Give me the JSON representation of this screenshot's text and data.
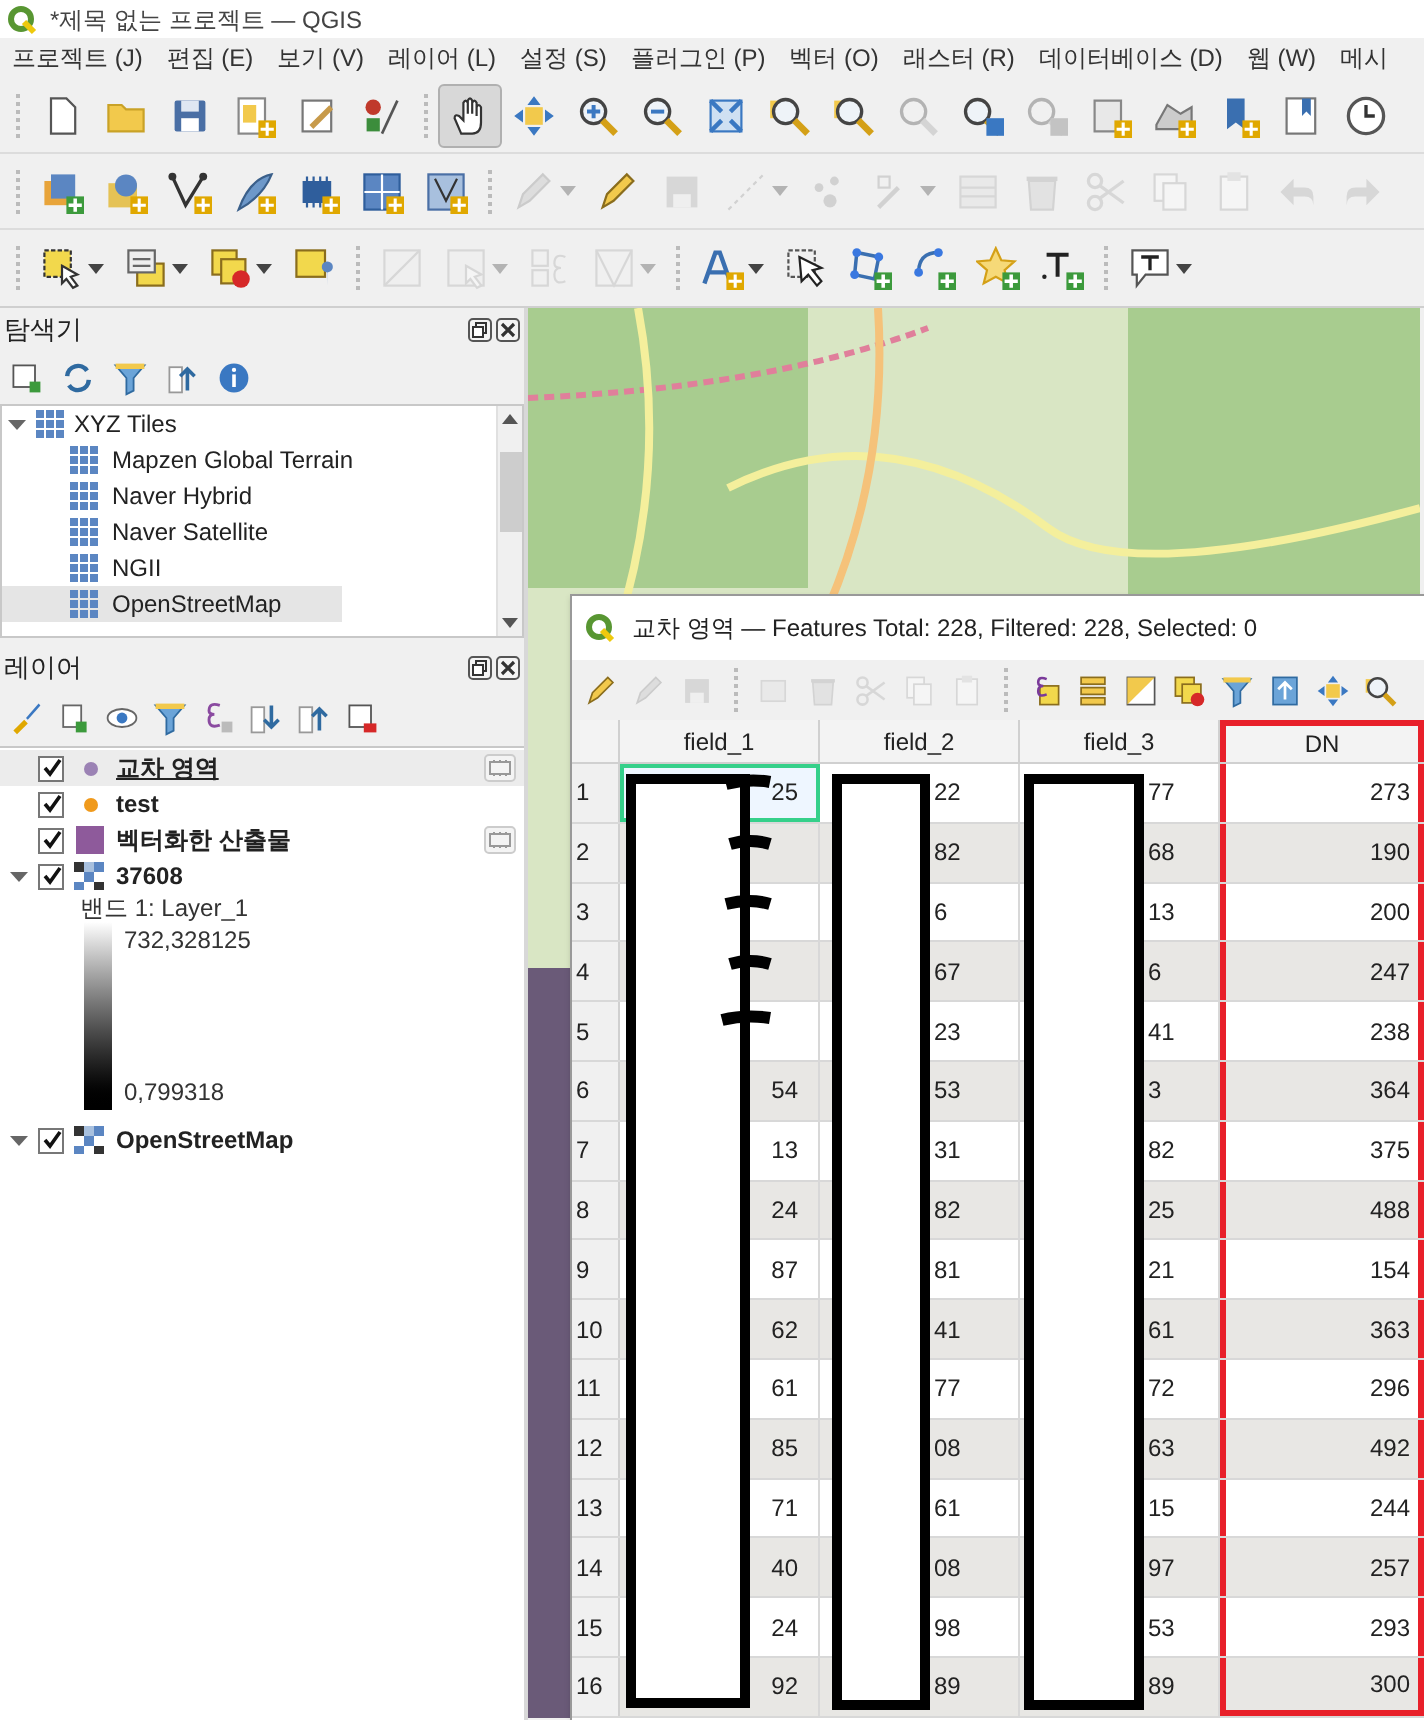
{
  "window": {
    "title": "*제목 없는 프로젝트 — QGIS"
  },
  "menu_bar": [
    "프로젝트 (J)",
    "편집 (E)",
    "보기 (V)",
    "레이어 (L)",
    "설정 (S)",
    "플러그인 (P)",
    "벡터 (O)",
    "래스터 (R)",
    "데이터베이스 (D)",
    "웹 (W)",
    "메시"
  ],
  "toolbars": [
    [
      {
        "kind": "new-file",
        "disabled": false,
        "active": false,
        "dropdown": false
      },
      {
        "kind": "open",
        "disabled": false,
        "active": false,
        "dropdown": false
      },
      {
        "kind": "save",
        "disabled": false,
        "active": false,
        "dropdown": false
      },
      {
        "kind": "new-layout",
        "disabled": false,
        "active": false,
        "dropdown": false
      },
      {
        "kind": "layout-manager",
        "disabled": false,
        "active": false,
        "dropdown": false
      },
      {
        "kind": "style-manager",
        "disabled": false,
        "active": false,
        "dropdown": false
      },
      {
        "kind": "separator",
        "disabled": false,
        "active": false,
        "dropdown": false
      },
      {
        "kind": "pan",
        "disabled": false,
        "active": true,
        "dropdown": false
      },
      {
        "kind": "pan-selection",
        "disabled": false,
        "active": false,
        "dropdown": false
      },
      {
        "kind": "zoom-in",
        "disabled": false,
        "active": false,
        "dropdown": false
      },
      {
        "kind": "zoom-out",
        "disabled": false,
        "active": false,
        "dropdown": false
      },
      {
        "kind": "zoom-full",
        "disabled": false,
        "active": false,
        "dropdown": false
      },
      {
        "kind": "zoom-layer",
        "disabled": false,
        "active": false,
        "dropdown": false
      },
      {
        "kind": "zoom-selection",
        "disabled": false,
        "active": false,
        "dropdown": false
      },
      {
        "kind": "zoom-native",
        "disabled": true,
        "active": false,
        "dropdown": false
      },
      {
        "kind": "zoom-last",
        "disabled": false,
        "active": false,
        "dropdown": false
      },
      {
        "kind": "zoom-next",
        "disabled": true,
        "active": false,
        "dropdown": false
      },
      {
        "kind": "map-view",
        "disabled": false,
        "active": false,
        "dropdown": false
      },
      {
        "kind": "terrain-view",
        "disabled": false,
        "active": false,
        "dropdown": false
      },
      {
        "kind": "new-bookmark",
        "disabled": false,
        "active": false,
        "dropdown": false
      },
      {
        "kind": "show-bookmarks",
        "disabled": false,
        "active": false,
        "dropdown": false
      },
      {
        "kind": "temporal",
        "disabled": false,
        "active": false,
        "dropdown": false
      }
    ],
    [
      {
        "kind": "add-layer",
        "disabled": false,
        "active": false,
        "dropdown": false
      },
      {
        "kind": "add-xyz",
        "disabled": false,
        "active": false,
        "dropdown": false
      },
      {
        "kind": "vertex",
        "disabled": false,
        "active": false,
        "dropdown": false
      },
      {
        "kind": "digitize",
        "disabled": false,
        "active": false,
        "dropdown": false
      },
      {
        "kind": "chip",
        "disabled": false,
        "active": false,
        "dropdown": false
      },
      {
        "kind": "grid",
        "disabled": false,
        "active": false,
        "dropdown": false
      },
      {
        "kind": "polygon-vertex",
        "disabled": false,
        "active": false,
        "dropdown": false
      },
      {
        "kind": "separator",
        "disabled": false,
        "active": false,
        "dropdown": false
      },
      {
        "kind": "pencil-multi",
        "disabled": true,
        "active": false,
        "dropdown": true
      },
      {
        "kind": "pencil",
        "disabled": false,
        "active": false,
        "dropdown": false
      },
      {
        "kind": "save-edits",
        "disabled": true,
        "active": false,
        "dropdown": false
      },
      {
        "kind": "line",
        "disabled": true,
        "active": false,
        "dropdown": true
      },
      {
        "kind": "points",
        "disabled": true,
        "active": false,
        "dropdown": false
      },
      {
        "kind": "node",
        "disabled": true,
        "active": false,
        "dropdown": true
      },
      {
        "kind": "table-edit",
        "disabled": true,
        "active": false,
        "dropdown": false
      },
      {
        "kind": "delete",
        "disabled": true,
        "active": false,
        "dropdown": false
      },
      {
        "kind": "cut",
        "disabled": true,
        "active": false,
        "dropdown": false
      },
      {
        "kind": "copy",
        "disabled": true,
        "active": false,
        "dropdown": false
      },
      {
        "kind": "paste",
        "disabled": true,
        "active": false,
        "dropdown": false
      },
      {
        "kind": "undo",
        "disabled": true,
        "active": false,
        "dropdown": false
      },
      {
        "kind": "redo",
        "disabled": true,
        "active": false,
        "dropdown": false
      }
    ],
    [
      {
        "kind": "select-rect",
        "disabled": false,
        "active": false,
        "dropdown": true
      },
      {
        "kind": "select-attr",
        "disabled": false,
        "active": false,
        "dropdown": true
      },
      {
        "kind": "deselect",
        "disabled": false,
        "active": false,
        "dropdown": true
      },
      {
        "kind": "select-location",
        "disabled": false,
        "active": false,
        "dropdown": false
      },
      {
        "kind": "separator",
        "disabled": false,
        "active": false,
        "dropdown": false
      },
      {
        "kind": "edit-grid",
        "disabled": true,
        "active": false,
        "dropdown": false
      },
      {
        "kind": "select-grid",
        "disabled": true,
        "active": false,
        "dropdown": true
      },
      {
        "kind": "expression-grid",
        "disabled": true,
        "active": false,
        "dropdown": false
      },
      {
        "kind": "mesh",
        "disabled": true,
        "active": false,
        "dropdown": true
      },
      {
        "kind": "separator",
        "disabled": false,
        "active": false,
        "dropdown": false
      },
      {
        "kind": "label",
        "disabled": false,
        "active": false,
        "dropdown": true
      },
      {
        "kind": "pointer",
        "disabled": false,
        "active": false,
        "dropdown": false
      },
      {
        "kind": "add-polygon",
        "disabled": false,
        "active": false,
        "dropdown": false
      },
      {
        "kind": "add-line",
        "disabled": false,
        "active": false,
        "dropdown": false
      },
      {
        "kind": "add-star",
        "disabled": false,
        "active": false,
        "dropdown": false
      },
      {
        "kind": "add-text",
        "disabled": false,
        "active": false,
        "dropdown": false
      },
      {
        "kind": "separator",
        "disabled": false,
        "active": false,
        "dropdown": false
      },
      {
        "kind": "annotation",
        "disabled": false,
        "active": false,
        "dropdown": true
      }
    ]
  ],
  "browser_panel": {
    "title": "탐색기",
    "tree": [
      {
        "label": "XYZ Tiles",
        "expanded": true,
        "selected": false,
        "children": [
          {
            "label": "Mapzen Global Terrain",
            "selected": false
          },
          {
            "label": "Naver Hybrid",
            "selected": false
          },
          {
            "label": "Naver Satellite",
            "selected": false
          },
          {
            "label": "NGII",
            "selected": false
          },
          {
            "label": "OpenStreetMap",
            "selected": true
          }
        ]
      }
    ]
  },
  "layers_panel": {
    "title": "레이어",
    "layers": [
      {
        "kind": "point",
        "name": "교차 영역",
        "checked": true,
        "selected": true,
        "indicator": true,
        "color": "#9b82b4"
      },
      {
        "kind": "point",
        "name": "test",
        "checked": true,
        "selected": false,
        "indicator": false,
        "color": "#f09a1c"
      },
      {
        "kind": "polygon",
        "name": "벡터화한 산출물",
        "checked": true,
        "selected": false,
        "indicator": true,
        "color": "#8e5a9b"
      },
      {
        "kind": "raster",
        "name": "37608",
        "checked": true,
        "selected": false,
        "expanded": true,
        "indicator": false,
        "legend": {
          "band": "밴드 1: Layer_1",
          "max": "732,328125",
          "min": "0,799318"
        }
      },
      {
        "kind": "raster",
        "name": "OpenStreetMap",
        "checked": true,
        "selected": false,
        "expanded": true,
        "indicator": false
      }
    ]
  },
  "attribute_table": {
    "title": "교차 영역 — Features Total: 228, Filtered: 228, Selected: 0",
    "toolbar": [
      {
        "kind": "pencil",
        "disabled": false
      },
      {
        "kind": "pencil-multi",
        "disabled": true
      },
      {
        "kind": "save-edits",
        "disabled": true
      },
      {
        "kind": "separator",
        "disabled": false
      },
      {
        "kind": "add-feature",
        "disabled": true
      },
      {
        "kind": "delete",
        "disabled": true
      },
      {
        "kind": "cut",
        "disabled": true
      },
      {
        "kind": "copy",
        "disabled": true
      },
      {
        "kind": "paste",
        "disabled": true
      },
      {
        "kind": "separator",
        "disabled": false
      },
      {
        "kind": "expression-select",
        "disabled": false
      },
      {
        "kind": "select-all",
        "disabled": false
      },
      {
        "kind": "invert",
        "disabled": false
      },
      {
        "kind": "deselect",
        "disabled": false
      },
      {
        "kind": "filter",
        "disabled": false
      },
      {
        "kind": "move-top",
        "disabled": false
      },
      {
        "kind": "pan-selection",
        "disabled": false
      },
      {
        "kind": "zoom-selection",
        "disabled": false
      }
    ],
    "columns": [
      {
        "label": "field_1",
        "highlighted": false
      },
      {
        "label": "field_2",
        "highlighted": false
      },
      {
        "label": "field_3",
        "highlighted": false
      },
      {
        "label": "DN",
        "highlighted": true
      }
    ],
    "rows": [
      {
        "number": "1",
        "focused": true,
        "cells": [
          "25",
          "22",
          "77",
          "273"
        ]
      },
      {
        "number": "2",
        "focused": false,
        "cells": [
          null,
          "82",
          "68",
          "190"
        ]
      },
      {
        "number": "3",
        "focused": false,
        "cells": [
          null,
          "6",
          "13",
          "200"
        ]
      },
      {
        "number": "4",
        "focused": false,
        "cells": [
          null,
          "67",
          "6",
          "247"
        ]
      },
      {
        "number": "5",
        "focused": false,
        "cells": [
          null,
          "23",
          "41",
          "238"
        ]
      },
      {
        "number": "6",
        "focused": false,
        "cells": [
          "54",
          "53",
          "3",
          "364"
        ]
      },
      {
        "number": "7",
        "focused": false,
        "cells": [
          "13",
          "31",
          "82",
          "375"
        ]
      },
      {
        "number": "8",
        "focused": false,
        "cells": [
          "24",
          "82",
          "25",
          "488"
        ]
      },
      {
        "number": "9",
        "focused": false,
        "cells": [
          "87",
          "81",
          "21",
          "154"
        ]
      },
      {
        "number": "10",
        "focused": false,
        "cells": [
          "62",
          "41",
          "61",
          "363"
        ]
      },
      {
        "number": "11",
        "focused": false,
        "cells": [
          "61",
          "77",
          "72",
          "296"
        ]
      },
      {
        "number": "12",
        "focused": false,
        "cells": [
          "85",
          "08",
          "63",
          "492"
        ]
      },
      {
        "number": "13",
        "focused": false,
        "cells": [
          "71",
          "61",
          "15",
          "244"
        ]
      },
      {
        "number": "14",
        "focused": false,
        "cells": [
          "40",
          "08",
          "97",
          "257"
        ]
      },
      {
        "number": "15",
        "focused": false,
        "cells": [
          "24",
          "98",
          "53",
          "293"
        ]
      },
      {
        "number": "16",
        "focused": false,
        "cells": [
          "92",
          "89",
          "89",
          "300"
        ]
      }
    ]
  }
}
